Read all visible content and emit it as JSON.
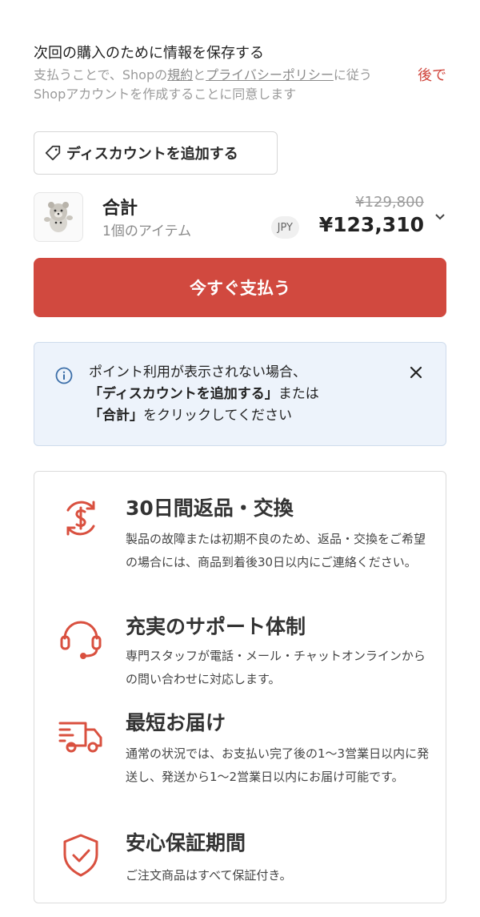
{
  "save_info": {
    "title": "次回の購入のために情報を保存する",
    "body_part1": "支払うことで、Shopの",
    "terms_link": "規約",
    "body_part2": "と",
    "privacy_link": "プライバシーポリシー",
    "body_part3": "に従うShopアカウントを作成することに同意します",
    "later_label": "後で"
  },
  "discount": {
    "label": "ディスカウントを追加する"
  },
  "summary": {
    "total_label": "合計",
    "item_count": "1個のアイテム",
    "original_price": "¥129,800",
    "currency": "JPY",
    "final_price": "¥123,310"
  },
  "pay_button": {
    "label": "今すぐ支払う"
  },
  "info_banner": {
    "line1": "ポイント利用が表示されない場合、",
    "line2_bold": "「ディスカウントを追加する」",
    "line2_rest": "または",
    "line3_bold": "「合計」",
    "line3_rest": "をクリックしてください"
  },
  "features": [
    {
      "icon": "refund-exchange-icon",
      "title": "30日間返品・交換",
      "desc": "製品の故障または初期不良のため、返品・交換をご希望の場合には、商品到着後30日以内にご連絡ください。"
    },
    {
      "icon": "headset-icon",
      "title": "充実のサポート体制",
      "desc": "専門スタッフが電話・メール・チャットオンラインからの問い合わせに対応します。"
    },
    {
      "icon": "delivery-truck-icon",
      "title": "最短お届け",
      "desc": "通常の状況では、お支払い完了後の1〜3営業日以内に発送し、発送から1〜2営業日以内にお届け可能です。"
    },
    {
      "icon": "shield-check-icon",
      "title": "安心保証期間",
      "desc": "ご注文商品はすべて保証付き。"
    }
  ],
  "colors": {
    "accent": "#d1493f",
    "banner_bg": "#edf3fb",
    "info_blue": "#3b6ea8"
  }
}
